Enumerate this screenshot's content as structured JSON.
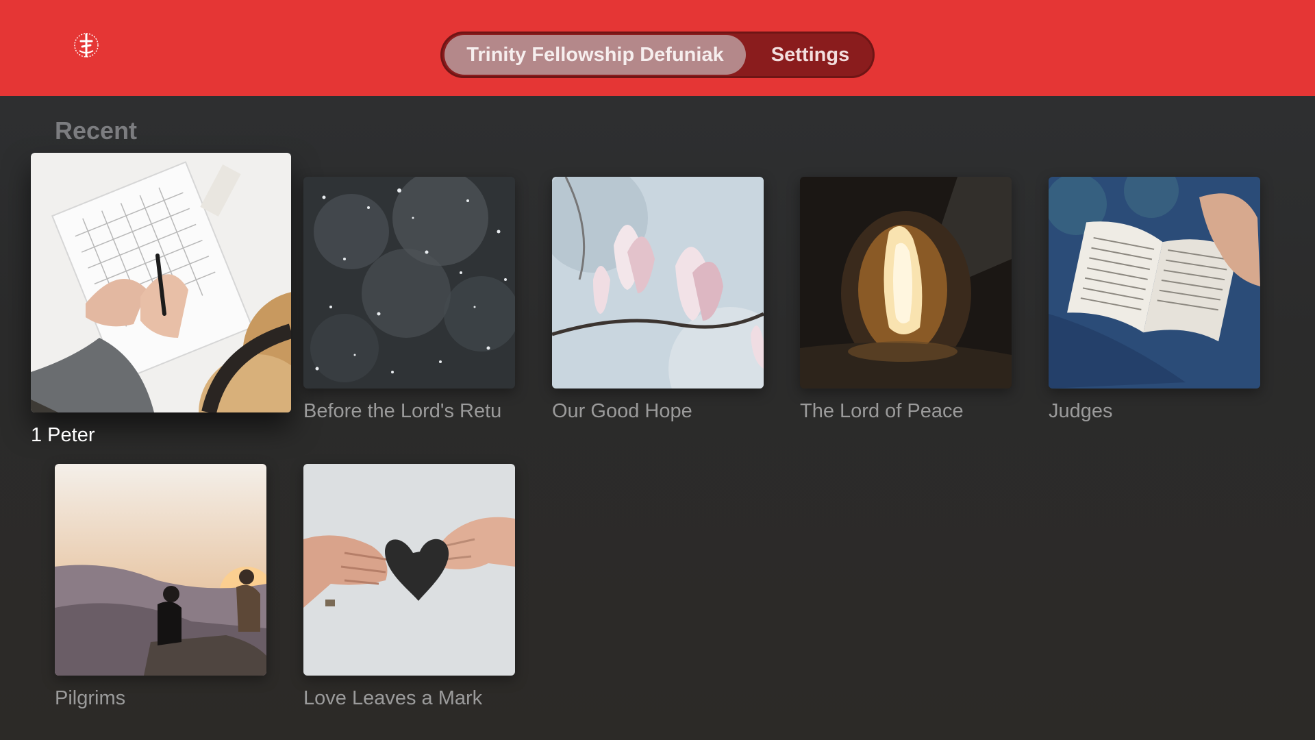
{
  "header": {
    "logo_icon": "trinity-fellowship-logo-icon",
    "tabs": [
      {
        "label": "Trinity Fellowship Defuniak",
        "selected": true
      },
      {
        "label": "Settings",
        "selected": false
      }
    ],
    "accent_color": "#e53635"
  },
  "recent": {
    "title": "Recent",
    "items": [
      {
        "title": "1 Peter",
        "focused": true,
        "image": "planner-notebook-hands-hat"
      },
      {
        "title": "Before the Lord's Retu",
        "focused": false,
        "image": "falling-snow"
      },
      {
        "title": "Our Good Hope",
        "focused": false,
        "image": "magnolia-blossoms"
      },
      {
        "title": "The Lord of Peace",
        "focused": false,
        "image": "empty-tomb-light"
      },
      {
        "title": "Judges",
        "focused": false,
        "image": "open-bible-hand"
      },
      {
        "title": "Pilgrims",
        "focused": false,
        "image": "people-mountain-sunset"
      },
      {
        "title": "Love Leaves a Mark",
        "focused": false,
        "image": "hands-paper-heart"
      }
    ]
  }
}
